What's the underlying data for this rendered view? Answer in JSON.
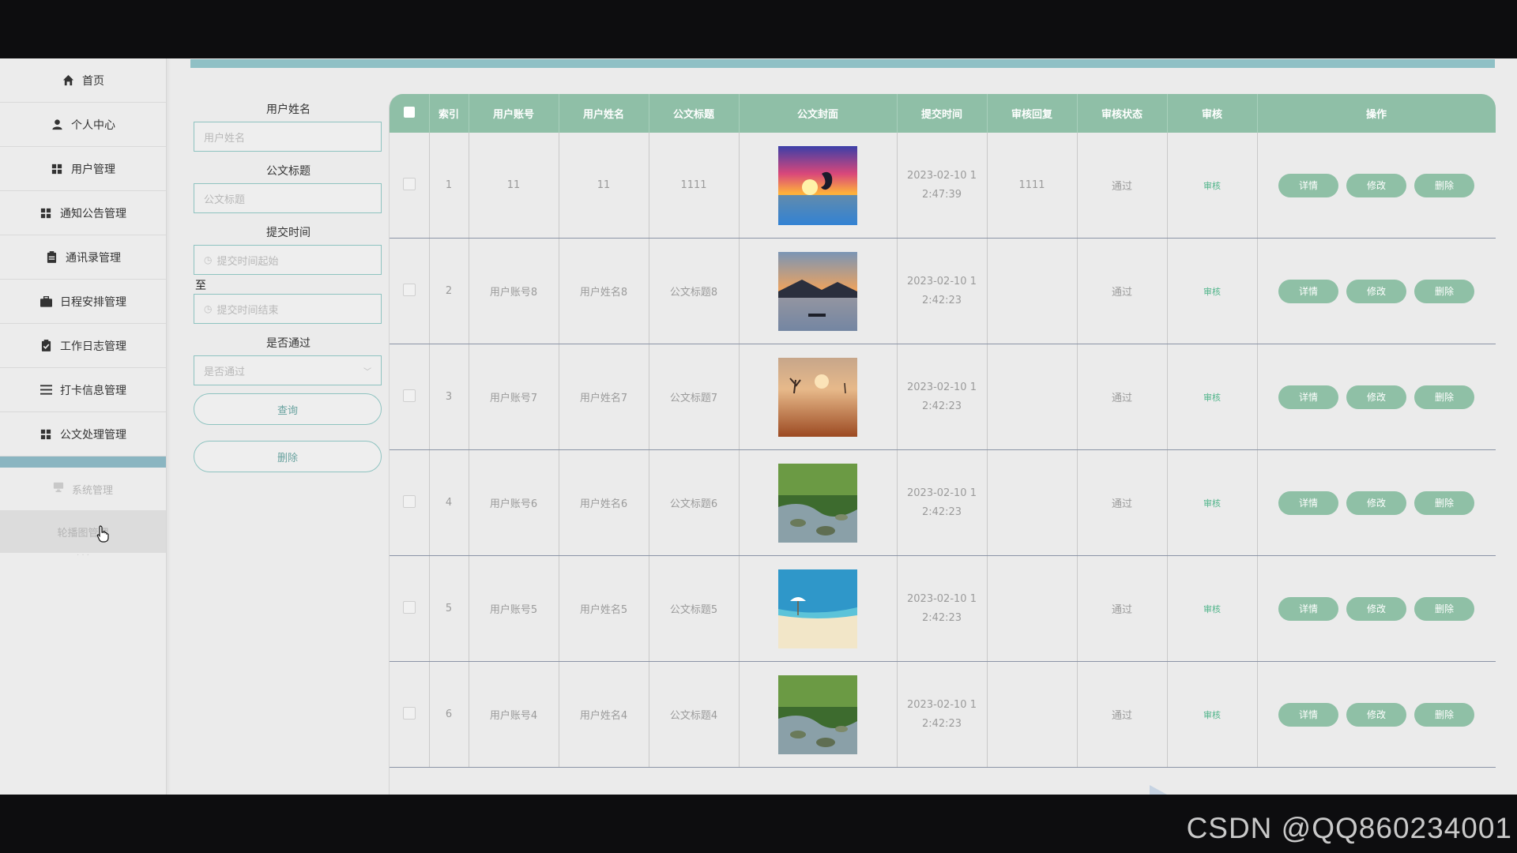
{
  "sidebar": {
    "items": [
      {
        "label": "首页",
        "icon": "home-icon"
      },
      {
        "label": "个人中心",
        "icon": "user-icon"
      },
      {
        "label": "用户管理",
        "icon": "grid-icon"
      },
      {
        "label": "通知公告管理",
        "icon": "grid-icon"
      },
      {
        "label": "通讯录管理",
        "icon": "clipboard-icon"
      },
      {
        "label": "日程安排管理",
        "icon": "briefcase-icon"
      },
      {
        "label": "工作日志管理",
        "icon": "clipboard-check-icon"
      },
      {
        "label": "打卡信息管理",
        "icon": "list-icon"
      },
      {
        "label": "公文处理管理",
        "icon": "grid-icon"
      }
    ],
    "sub_items": [
      {
        "label": "系统管理",
        "icon": "monitor-icon"
      },
      {
        "label": "轮播图管理"
      }
    ]
  },
  "search": {
    "name_label": "用户姓名",
    "name_placeholder": "用户姓名",
    "title_label": "公文标题",
    "title_placeholder": "公文标题",
    "time_label": "提交时间",
    "time_start_placeholder": "提交时间起始",
    "time_to": "至",
    "time_end_placeholder": "提交时间结束",
    "pass_label": "是否通过",
    "pass_placeholder": "是否通过",
    "query_button": "查询",
    "delete_button": "删除"
  },
  "table": {
    "columns": [
      "索引",
      "用户账号",
      "用户姓名",
      "公文标题",
      "公文封面",
      "提交时间",
      "审核回复",
      "审核状态",
      "审核",
      "操作"
    ],
    "rows": [
      {
        "index": "1",
        "account": "11",
        "name": "11",
        "title": "1111",
        "cover": "dolphin-sunset-image",
        "time1": "2023-02-10 1",
        "time2": "2:47:39",
        "reply": "1111",
        "status": "通过",
        "audit": "审核"
      },
      {
        "index": "2",
        "account": "用户账号8",
        "name": "用户姓名8",
        "title": "公文标题8",
        "cover": "boat-sunrise-image",
        "time1": "2023-02-10 1",
        "time2": "2:42:23",
        "reply": "",
        "status": "通过",
        "audit": "审核"
      },
      {
        "index": "3",
        "account": "用户账号7",
        "name": "用户姓名7",
        "title": "公文标题7",
        "cover": "desert-tree-image",
        "time1": "2023-02-10 1",
        "time2": "2:42:23",
        "reply": "",
        "status": "通过",
        "audit": "审核"
      },
      {
        "index": "4",
        "account": "用户账号6",
        "name": "用户姓名6",
        "title": "公文标题6",
        "cover": "forest-stream-image",
        "time1": "2023-02-10 1",
        "time2": "2:42:23",
        "reply": "",
        "status": "通过",
        "audit": "审核"
      },
      {
        "index": "5",
        "account": "用户账号5",
        "name": "用户姓名5",
        "title": "公文标题5",
        "cover": "beach-umbrella-image",
        "time1": "2023-02-10 1",
        "time2": "2:42:23",
        "reply": "",
        "status": "通过",
        "audit": "审核"
      },
      {
        "index": "6",
        "account": "用户账号4",
        "name": "用户姓名4",
        "title": "公文标题4",
        "cover": "forest-stream-image",
        "time1": "2023-02-10 1",
        "time2": "2:42:23",
        "reply": "",
        "status": "通过",
        "audit": "审核"
      }
    ],
    "actions": {
      "detail": "详情",
      "edit": "修改",
      "delete": "删除"
    }
  },
  "watermark": "CSDN @QQ860234001",
  "colors": {
    "accent": "#8fbfa7",
    "topbar": "#8fc0c5",
    "link": "#52b58b"
  }
}
